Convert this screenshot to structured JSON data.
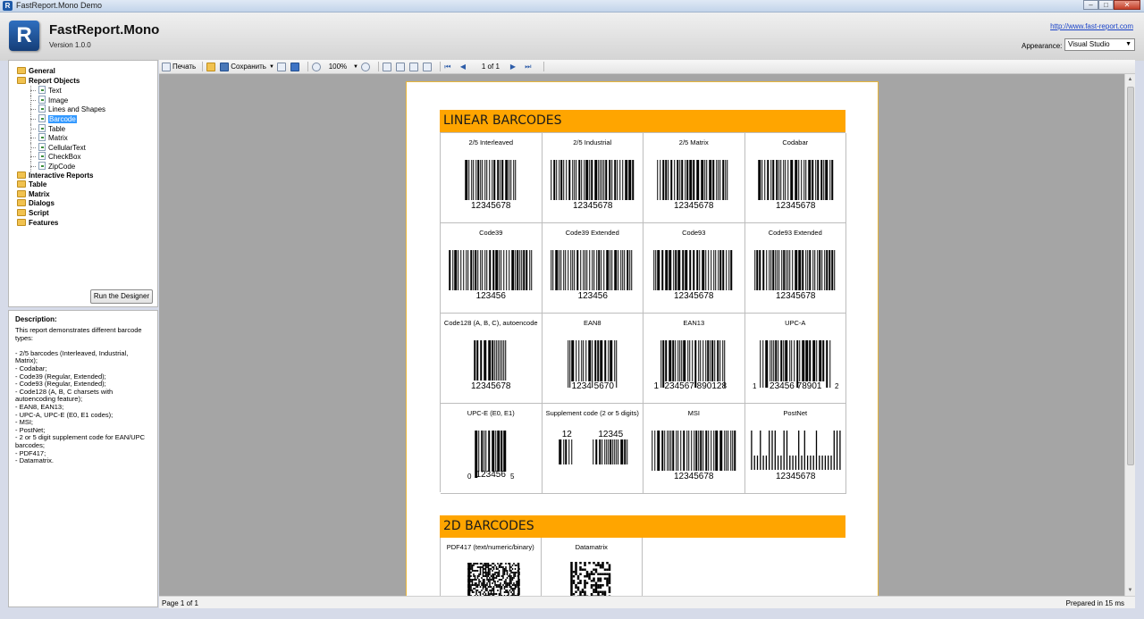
{
  "window": {
    "title": "FastReport.Mono Demo",
    "minimize": "–",
    "maximize": "□",
    "close": "✕"
  },
  "header": {
    "logo_letter": "R",
    "app_name": "FastReport.Mono",
    "version": "Version 1.0.0",
    "site_url": "http://www.fast-report.com",
    "appearance_label": "Appearance:",
    "appearance_value": "Visual Studio"
  },
  "tree": [
    {
      "label": "General",
      "type": "folder",
      "level": 0
    },
    {
      "label": "Report Objects",
      "type": "folder",
      "level": 0
    },
    {
      "label": "Text",
      "type": "doc",
      "level": 1
    },
    {
      "label": "Image",
      "type": "doc",
      "level": 1
    },
    {
      "label": "Lines and Shapes",
      "type": "doc",
      "level": 1
    },
    {
      "label": "Barcode",
      "type": "doc",
      "level": 1,
      "selected": true
    },
    {
      "label": "Table",
      "type": "doc",
      "level": 1
    },
    {
      "label": "Matrix",
      "type": "doc",
      "level": 1
    },
    {
      "label": "CellularText",
      "type": "doc",
      "level": 1
    },
    {
      "label": "CheckBox",
      "type": "doc",
      "level": 1
    },
    {
      "label": "ZipCode",
      "type": "doc",
      "level": 1
    },
    {
      "label": "Interactive Reports",
      "type": "folder",
      "level": 0
    },
    {
      "label": "Table",
      "type": "folder",
      "level": 0
    },
    {
      "label": "Matrix",
      "type": "folder",
      "level": 0
    },
    {
      "label": "Dialogs",
      "type": "folder",
      "level": 0
    },
    {
      "label": "Script",
      "type": "folder",
      "level": 0
    },
    {
      "label": "Features",
      "type": "folder",
      "level": 0
    }
  ],
  "run_designer": "Run the Designer",
  "description": {
    "title": "Description:",
    "text": "This report demonstrates different barcode types:\n\n- 2/5 barcodes (Interleaved, Industrial, Matrix);\n- Codabar;\n- Code39 (Regular, Extended);\n- Code93 (Regular, Extended);\n- Code128 (A, B, C charsets with autoencoding feature);\n- EAN8, EAN13;\n- UPC-A, UPC-E (E0, E1 codes);\n- MSI;\n- PostNet;\n- 2 or 5 digit supplement code for EAN/UPC barcodes;\n- PDF417;\n- Datamatrix."
  },
  "toolbar": {
    "print": "Печать",
    "save": "Сохранить",
    "zoom": "100%",
    "page_indicator": "1 of 1"
  },
  "report": {
    "linear_title": "LINEAR BARCODES",
    "twod_title": "2D BARCODES",
    "linear": [
      {
        "name": "2/5 Interleaved",
        "text": "12345678",
        "kind": "std"
      },
      {
        "name": "2/5 Industrial",
        "text": "12345678",
        "kind": "std"
      },
      {
        "name": "2/5 Matrix",
        "text": "12345678",
        "kind": "std"
      },
      {
        "name": "Codabar",
        "text": "12345678",
        "kind": "std"
      },
      {
        "name": "Code39",
        "text": "123456",
        "kind": "std"
      },
      {
        "name": "Code39 Extended",
        "text": "123456",
        "kind": "std"
      },
      {
        "name": "Code93",
        "text": "12345678",
        "kind": "std"
      },
      {
        "name": "Code93 Extended",
        "text": "12345678",
        "kind": "std"
      },
      {
        "name": "Code128 (A, B, C), autoencode",
        "text": "12345678",
        "kind": "std"
      },
      {
        "name": "EAN8",
        "text": "1234 5670",
        "kind": "ean8"
      },
      {
        "name": "EAN13",
        "text": "234567 890128",
        "prefix": "1",
        "kind": "ean13"
      },
      {
        "name": "UPC-A",
        "text": "23456 78901",
        "prefix": "1",
        "suffix": "2",
        "kind": "upca"
      },
      {
        "name": "UPC-E (E0, E1)",
        "text": "123456",
        "prefix": "0",
        "suffix": "5",
        "kind": "upce"
      },
      {
        "name": "Supplement code (2 or 5 digits)",
        "text": "12",
        "text2": "12345",
        "kind": "supp"
      },
      {
        "name": "MSI",
        "text": "12345678",
        "kind": "std"
      },
      {
        "name": "PostNet",
        "text": "12345678",
        "kind": "postnet"
      }
    ],
    "twod": [
      {
        "name": "PDF417 (text/numeric/binary)",
        "kind": "pdf417"
      },
      {
        "name": "Datamatrix",
        "kind": "datamatrix"
      }
    ]
  },
  "status": {
    "left": "Page 1 of 1",
    "right": "Prepared in 15 ms"
  }
}
